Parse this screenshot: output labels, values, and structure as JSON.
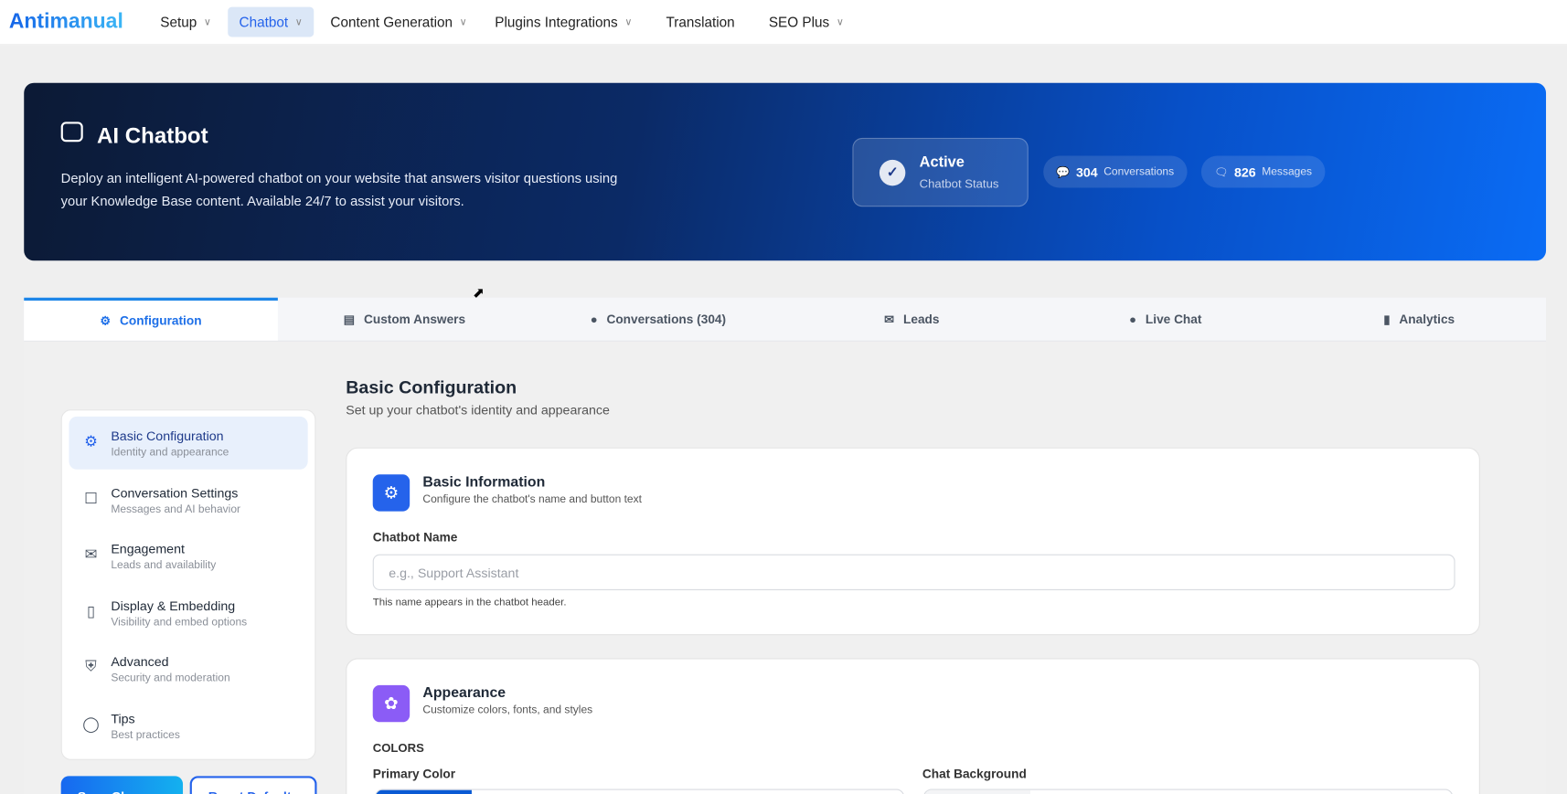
{
  "app": {
    "logo": "Antimanual"
  },
  "nav": [
    {
      "label": "Setup",
      "dropdown": true
    },
    {
      "label": "Chatbot",
      "dropdown": true,
      "active": true
    },
    {
      "label": "Content Generation",
      "dropdown": true
    },
    {
      "label": "Plugins Integrations",
      "dropdown": true
    },
    {
      "label": "Translation",
      "dropdown": false
    },
    {
      "label": "SEO Plus",
      "dropdown": true
    }
  ],
  "hero": {
    "title": "AI Chatbot",
    "description": "Deploy an intelligent AI-powered chatbot on your website that answers visitor questions using your Knowledge Base content. Available 24/7 to assist your visitors.",
    "status": {
      "value": "Active",
      "label": "Chatbot Status"
    },
    "conversations": {
      "count": "304",
      "label": "Conversations"
    },
    "messages": {
      "count": "826",
      "label": "Messages"
    }
  },
  "tabs": [
    {
      "label": "Configuration",
      "icon": "gear-icon",
      "active": true
    },
    {
      "label": "Custom Answers",
      "icon": "chat-boxes-icon"
    },
    {
      "label": "Conversations (304)",
      "icon": "comments-icon"
    },
    {
      "label": "Leads",
      "icon": "envelope-icon"
    },
    {
      "label": "Live Chat",
      "icon": "chat-bubble-icon"
    },
    {
      "label": "Analytics",
      "icon": "bar-chart-icon"
    }
  ],
  "sidebar": [
    {
      "title": "Basic Configuration",
      "subtitle": "Identity and appearance",
      "icon": "gear-icon",
      "active": true
    },
    {
      "title": "Conversation Settings",
      "subtitle": "Messages and AI behavior",
      "icon": "message-square-icon"
    },
    {
      "title": "Engagement",
      "subtitle": "Leads and availability",
      "icon": "envelope-icon"
    },
    {
      "title": "Display & Embedding",
      "subtitle": "Visibility and embed options",
      "icon": "mobile-icon"
    },
    {
      "title": "Advanced",
      "subtitle": "Security and moderation",
      "icon": "shield-icon"
    },
    {
      "title": "Tips",
      "subtitle": "Best practices",
      "icon": "lightbulb-icon"
    }
  ],
  "buttons": {
    "save": "Save Changes",
    "reset": "Reset Defaults"
  },
  "section": {
    "title": "Basic Configuration",
    "subtitle": "Set up your chatbot's identity and appearance"
  },
  "basic_info": {
    "title": "Basic Information",
    "subtitle": "Configure the chatbot's name and button text",
    "name_label": "Chatbot Name",
    "name_value": "",
    "name_placeholder": "e.g., Support Assistant",
    "name_hint": "This name appears in the chatbot header."
  },
  "appearance": {
    "title": "Appearance",
    "subtitle": "Customize colors, fonts, and styles",
    "colors_heading": "COLORS",
    "primary_label": "Primary Color",
    "primary_color": "#0a5ad4",
    "background_label": "Chat Background",
    "background_color": "#f3f4f6"
  }
}
